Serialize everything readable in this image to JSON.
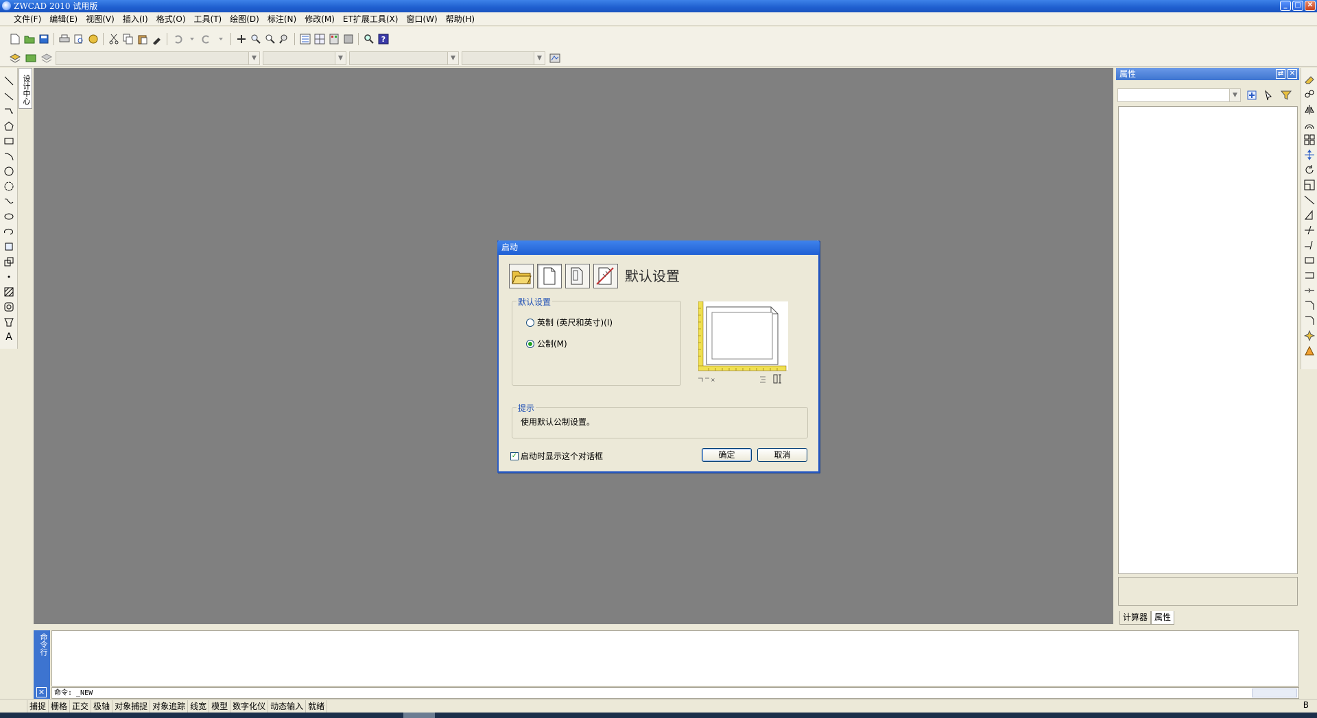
{
  "window": {
    "title": "ZWCAD 2010 试用版",
    "btn_min": "_",
    "btn_max": "□",
    "btn_close": "✕"
  },
  "menu": [
    "文件(F)",
    "编辑(E)",
    "视图(V)",
    "插入(I)",
    "格式(O)",
    "工具(T)",
    "绘图(D)",
    "标注(N)",
    "修改(M)",
    "ET扩展工具(X)",
    "窗口(W)",
    "帮助(H)"
  ],
  "design_center_tab": "设计中心",
  "properties_panel": {
    "title": "属性",
    "pin_label": "⇄",
    "close_label": "✕",
    "tabs": [
      "计算器",
      "属性"
    ],
    "active_tab": "属性"
  },
  "command": {
    "side_label": "命令行",
    "close_label": "✕",
    "prompt": "命令: _NEW"
  },
  "status_bar": {
    "items": [
      "捕捉",
      "栅格",
      "正交",
      "极轴",
      "对象捕捉",
      "对象追踪",
      "线宽",
      "模型",
      "数字化仪",
      "动态输入",
      "就绪"
    ],
    "right_text": "B"
  },
  "dialog": {
    "title": "启动",
    "mode_title": "默认设置",
    "settings_group": "默认设置",
    "options": [
      {
        "label": "英制 (英尺和英寸)(I)",
        "checked": false
      },
      {
        "label": "公制(M)",
        "checked": true
      }
    ],
    "hint_group": "提示",
    "hint_text": "使用默认公制设置。",
    "show_on_startup": "启动时显示这个对话框",
    "show_on_startup_checked": true,
    "ok": "确定",
    "cancel": "取消"
  },
  "colors": {
    "drawing_bg": "#808080",
    "titlebar": "#2060d4",
    "accent": "#3d74d0"
  }
}
